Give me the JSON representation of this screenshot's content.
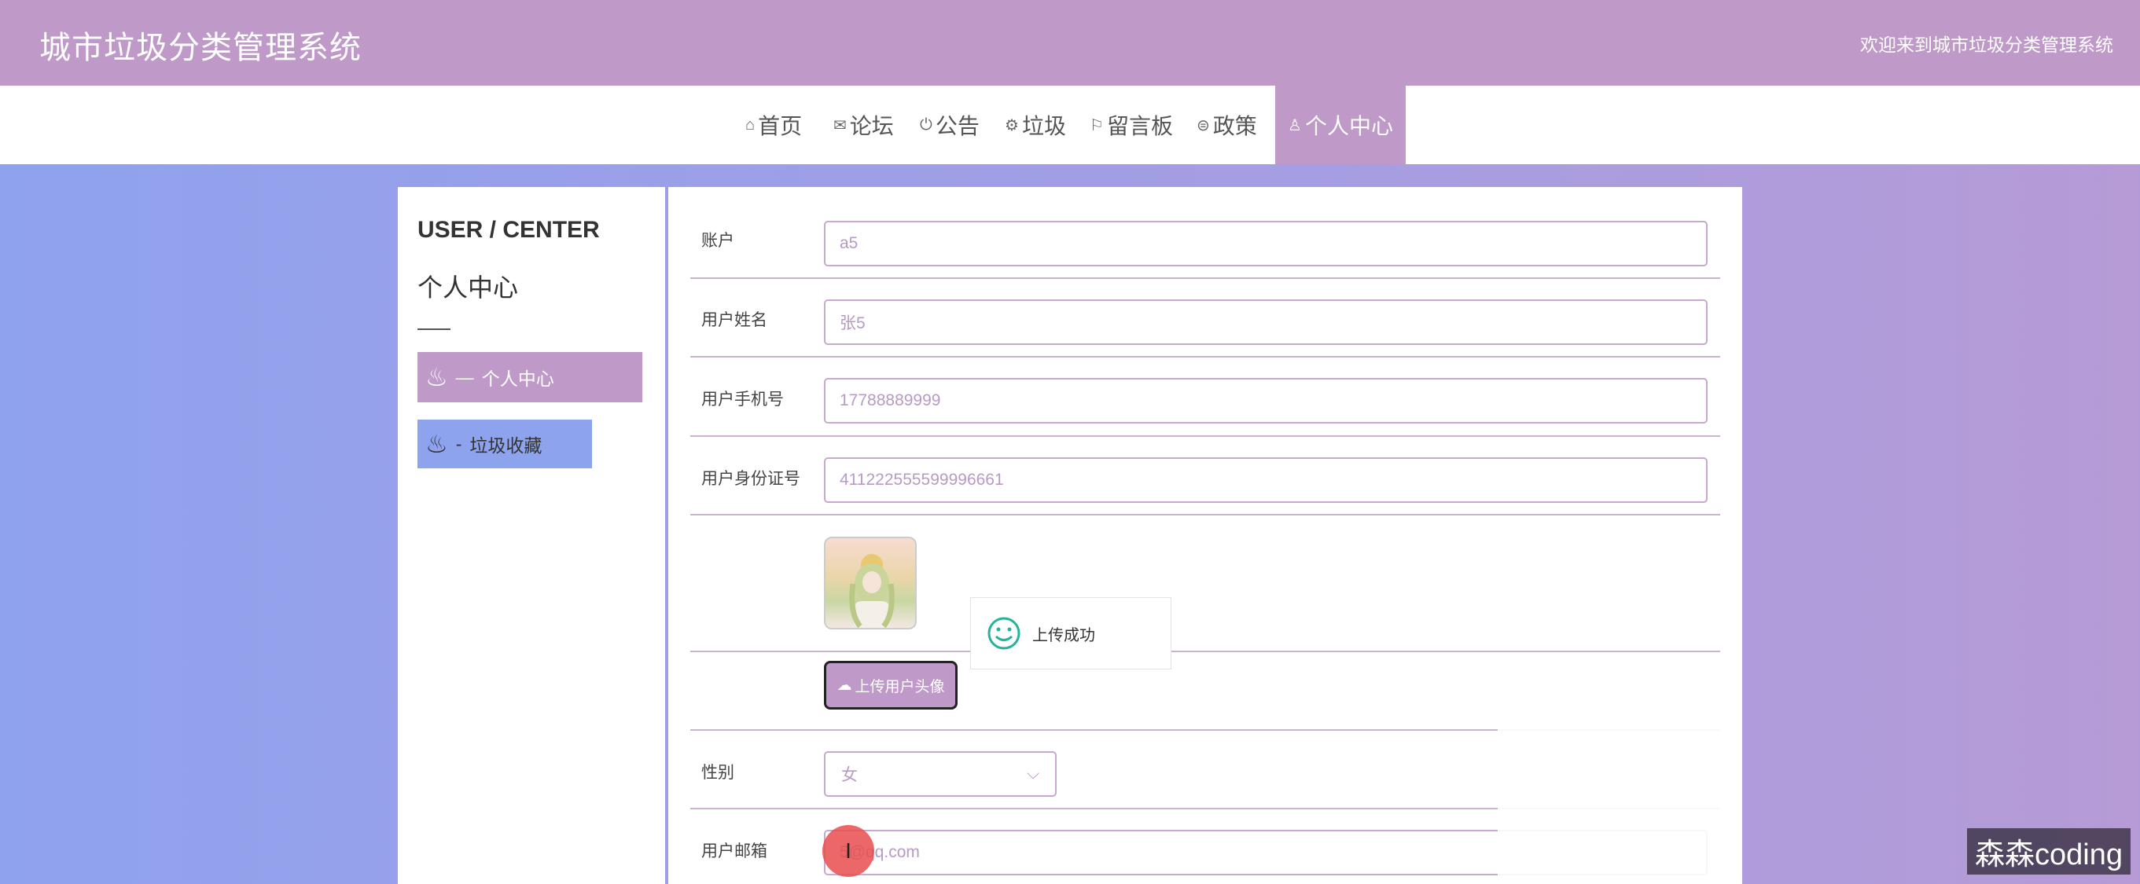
{
  "header": {
    "site_title": "城市垃圾分类管理系统",
    "welcome_text": "欢迎来到城市垃圾分类管理系统"
  },
  "nav": {
    "items": [
      {
        "icon": "home-icon",
        "glyph": "⌂",
        "label": "首页"
      },
      {
        "icon": "mail-icon",
        "glyph": "✉",
        "label": "论坛"
      },
      {
        "icon": "power-icon",
        "glyph": "⏻",
        "label": "公告"
      },
      {
        "icon": "gear-icon",
        "glyph": "⚙",
        "label": "垃圾"
      },
      {
        "icon": "flag-icon",
        "glyph": "⚐",
        "label": "留言板"
      },
      {
        "icon": "print-icon",
        "glyph": "⊜",
        "label": "政策"
      },
      {
        "icon": "user-icon",
        "glyph": "♙",
        "label": "个人中心"
      }
    ],
    "active": "个人中心"
  },
  "sidebar": {
    "title_en": "USER / CENTER",
    "title_cn": "个人中心",
    "items": [
      {
        "prefix": "—",
        "label": "个人中心"
      },
      {
        "prefix": "-",
        "label": "垃圾收藏"
      }
    ]
  },
  "form": {
    "account": {
      "label": "账户",
      "value": "a5"
    },
    "name": {
      "label": "用户姓名",
      "value": "张5"
    },
    "phone": {
      "label": "用户手机号",
      "value": "17788889999"
    },
    "id_card": {
      "label": "用户身份证号",
      "value": "411222555599996661"
    },
    "upload_button": "上传用户头像",
    "gender": {
      "label": "性别",
      "value": "女"
    },
    "email": {
      "label": "用户邮箱",
      "value": "5@qq.com"
    }
  },
  "toast": {
    "message": "上传成功"
  },
  "watermark": "森森coding",
  "colors": {
    "accent": "#bf9ac9",
    "secondary": "#8ea3ee",
    "success": "#27b397"
  }
}
